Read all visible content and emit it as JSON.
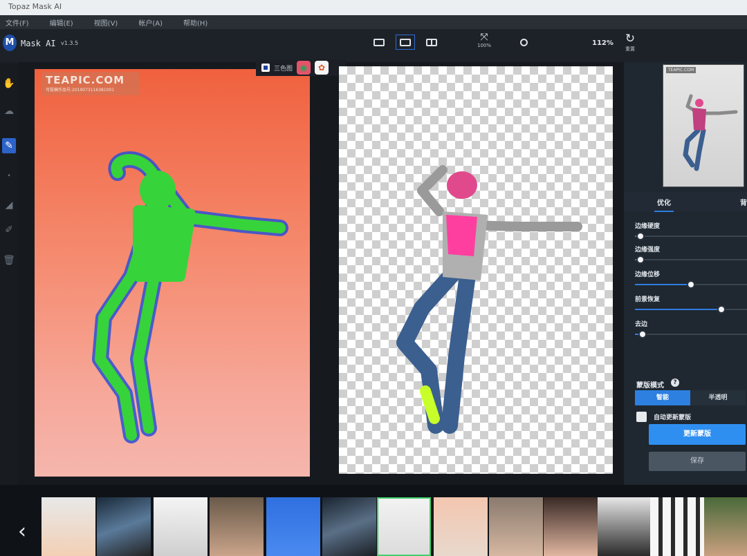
{
  "window": {
    "title": "Topaz Mask AI"
  },
  "menu": [
    "文件(F)",
    "编辑(E)",
    "视图(V)",
    "帐户(A)",
    "帮助(H)"
  ],
  "app": {
    "name": "Mask AI",
    "version": "v1.3.5",
    "logo_letter": "M"
  },
  "toolbar": {
    "fit_label": "100%",
    "zoom": "112%",
    "reset_label": "重置",
    "view_buttons": [
      "single-view",
      "side-by-side-view",
      "split-view"
    ],
    "active_view": "side-by-side-view"
  },
  "view_mode": {
    "label": "三色图"
  },
  "watermark": {
    "brand": "TEAPIC.COM",
    "line": "可投稿作品号:2019073116381001"
  },
  "preview": {
    "watermark": "TEAPIC.COM"
  },
  "panel": {
    "tabs": [
      "优化",
      "背"
    ],
    "sliders": [
      {
        "name": "边缘硬度",
        "value": 0.05
      },
      {
        "name": "边缘强度",
        "value": 0.05
      },
      {
        "name": "边缘位移",
        "value": 0.5
      },
      {
        "name": "前景恢复",
        "value": 0.77
      },
      {
        "name": "去边",
        "value": 0.07
      }
    ],
    "mask_mode": {
      "title": "蒙版模式",
      "help": "?",
      "options": [
        "智能",
        "半透明"
      ],
      "selected": "智能"
    },
    "auto_update_label": "自动更新蒙版",
    "update_button": "更新蒙版",
    "save_button": "保存"
  },
  "filmstrip": {
    "arrow": "‹",
    "selected_index": 6,
    "count": 13
  },
  "colors": {
    "accent": "#2f7de0",
    "selection": "#3fd06a",
    "mask_green": "#37d33a",
    "mask_blue": "#2b4fd6"
  }
}
